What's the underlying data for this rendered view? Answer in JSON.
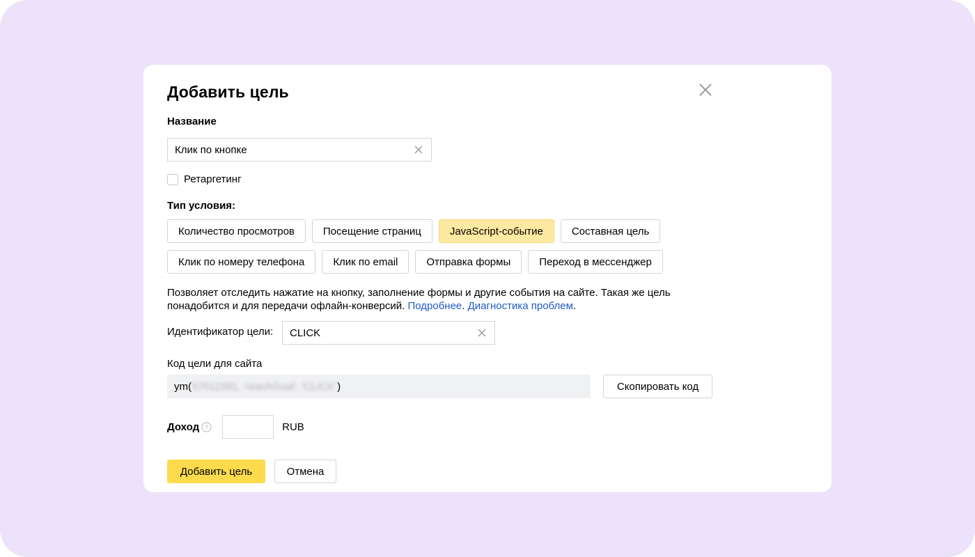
{
  "dialog": {
    "title": "Добавить цель",
    "close_icon": "close-icon"
  },
  "name_section": {
    "label": "Название",
    "value": "Клик по кнопке"
  },
  "retargeting": {
    "label": "Ретаргетинг",
    "checked": false
  },
  "condition_type": {
    "label": "Тип условия:",
    "row1": [
      {
        "label": "Количество просмотров",
        "active": false
      },
      {
        "label": "Посещение страниц",
        "active": false
      },
      {
        "label": "JavaScript-событие",
        "active": true
      },
      {
        "label": "Составная цель",
        "active": false
      }
    ],
    "row2": [
      {
        "label": "Клик по номеру телефона",
        "active": false
      },
      {
        "label": "Клик по email",
        "active": false
      },
      {
        "label": "Отправка формы",
        "active": false
      },
      {
        "label": "Переход в мессенджер",
        "active": false
      }
    ]
  },
  "description": {
    "text": "Позволяет отследить нажатие на кнопку, заполнение формы и другие события на сайте. Такая же цель понадобится и для передачи офлайн-конверсий. ",
    "link_more": "Подробнее",
    "separator": ". ",
    "link_diagnostics": "Диагностика проблем",
    "end": "."
  },
  "goal_id": {
    "label": "Идентификатор цели:",
    "value": "CLICK"
  },
  "site_code": {
    "label": "Код цели для сайта",
    "prefix": "ym(",
    "blurred": "57011581, 'reachGoal', 'CLICK'",
    "suffix": ")",
    "copy_button": "Скопировать код"
  },
  "income": {
    "label": "Доход",
    "value": "",
    "currency": "RUB"
  },
  "actions": {
    "submit": "Добавить цель",
    "cancel": "Отмена"
  },
  "colors": {
    "background": "#ece2f9",
    "primary_button": "#fedb4d",
    "active_chip": "#fde9a2",
    "link": "#1e5bc6"
  }
}
